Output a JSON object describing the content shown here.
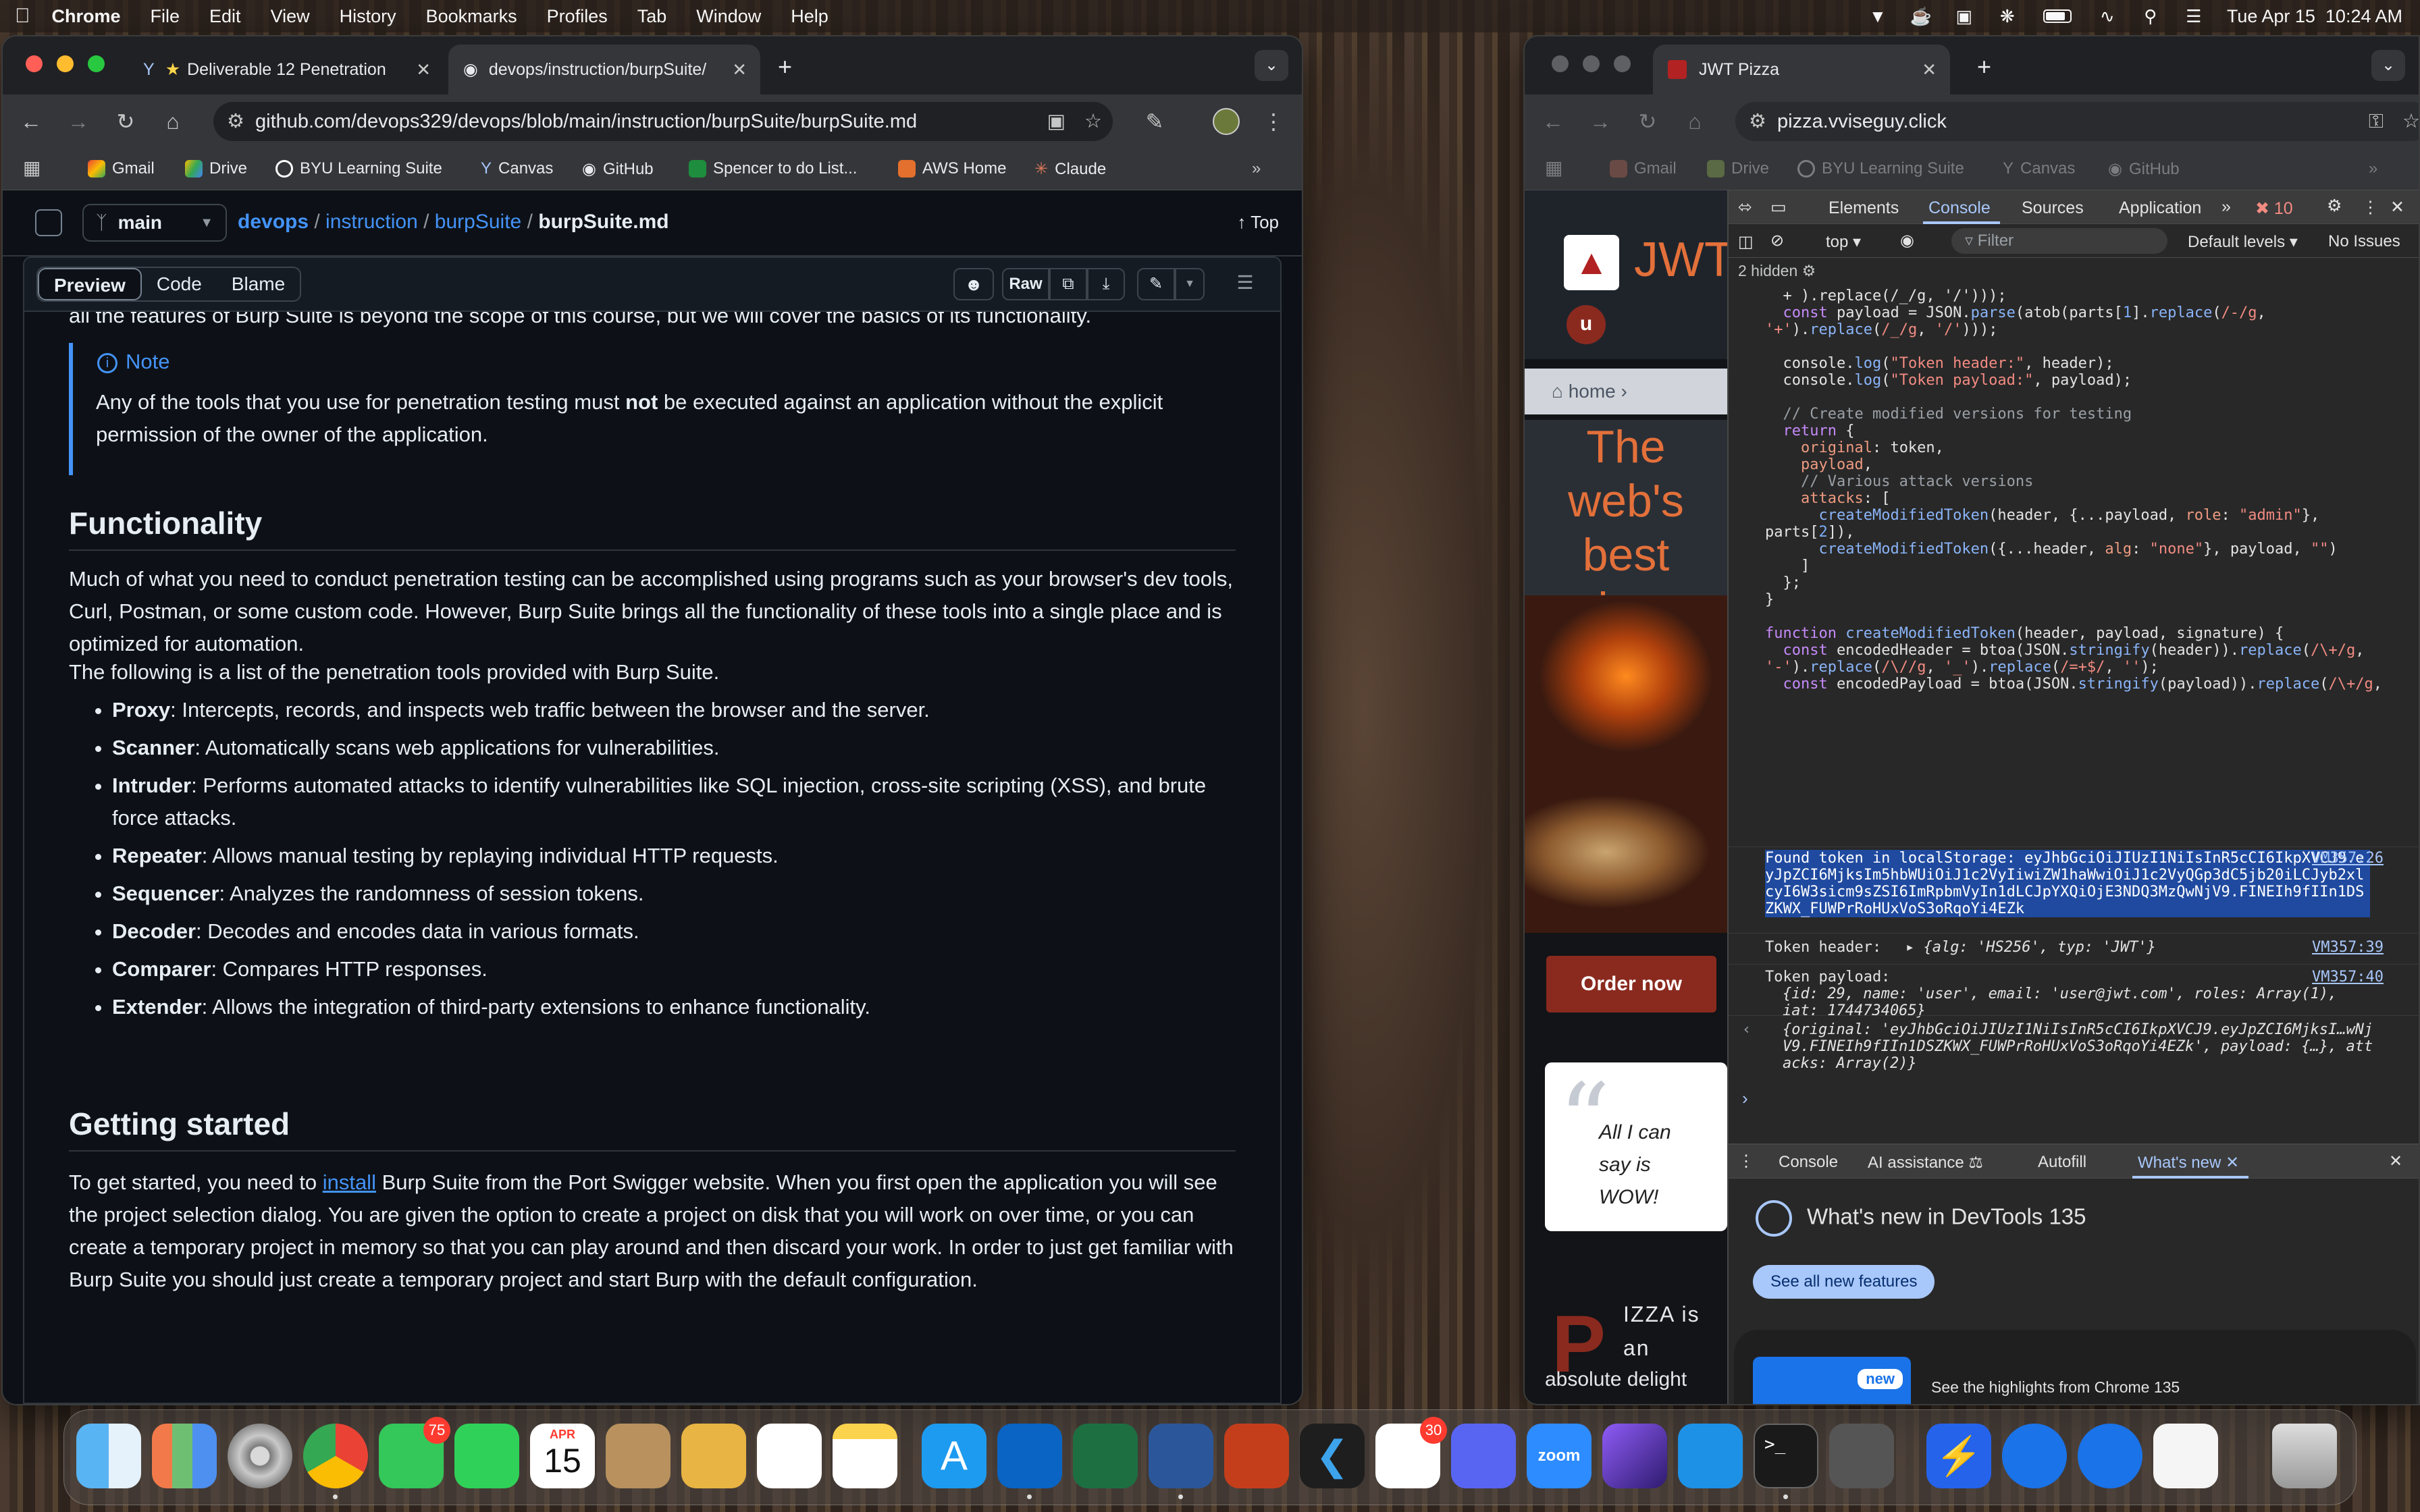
{
  "menubar": {
    "app": "Chrome",
    "items": [
      "File",
      "Edit",
      "View",
      "History",
      "Bookmarks",
      "Profiles",
      "Tab",
      "Window",
      "Help"
    ],
    "datetime": "Tue Apr 15  10:24 AM"
  },
  "left_window": {
    "tabs": [
      {
        "title": "Deliverable 12 Penetration",
        "active": false
      },
      {
        "title": "devops/instruction/burpSuite/",
        "active": true
      }
    ],
    "url": "github.com/devops329/devops/blob/main/instruction/burpSuite/burpSuite.md",
    "bookmarks": [
      "Gmail",
      "Drive",
      "BYU Learning Suite",
      "Canvas",
      "GitHub",
      "Spencer to do List...",
      "AWS Home",
      "Claude"
    ],
    "github": {
      "branch": "main",
      "breadcrumb": [
        "devops",
        "instruction",
        "burpSuite"
      ],
      "file": "burpSuite.md",
      "top_label": "Top",
      "view_tabs": [
        "Preview",
        "Code",
        "Blame"
      ],
      "raw_label": "Raw",
      "cut_line": "all the features of Burp Suite is beyond the scope of this course, but we will cover the basics of its functionality.",
      "note_title": "Note",
      "note_text_a": "Any of the tools that you use for penetration testing must ",
      "note_text_b": "not",
      "note_text_c": " be executed against an application without the explicit permission of the owner of the application.",
      "h_functionality": "Functionality",
      "p1": "Much of what you need to conduct penetration testing can be accomplished using programs such as your browser's dev tools, Curl, Postman, or some custom code. However, Burp Suite brings all the functionality of these tools into a single place and is optimized for automation.",
      "p2": "The following is a list of the penetration tools provided with Burp Suite.",
      "tools": [
        {
          "name": "Proxy",
          "desc": ": Intercepts, records, and inspects web traffic between the browser and the server."
        },
        {
          "name": "Scanner",
          "desc": ": Automatically scans web applications for vulnerabilities."
        },
        {
          "name": "Intruder",
          "desc": ": Performs automated attacks to identify vulnerabilities like SQL injection, cross-site scripting (XSS), and brute force attacks."
        },
        {
          "name": "Repeater",
          "desc": ": Allows manual testing by replaying individual HTTP requests."
        },
        {
          "name": "Sequencer",
          "desc": ": Analyzes the randomness of session tokens."
        },
        {
          "name": "Decoder",
          "desc": ": Decodes and encodes data in various formats."
        },
        {
          "name": "Comparer",
          "desc": ": Compares HTTP responses."
        },
        {
          "name": "Extender",
          "desc": ": Allows the integration of third-party extensions to enhance functionality."
        }
      ],
      "h_getting_started": "Getting started",
      "gs_a": "To get started, you need to ",
      "gs_link": "install",
      "gs_b": " Burp Suite from the Port Swigger website. When you first open the application you will see the project selection dialog. You are given the option to create a project on disk that you will work on over time, or you can create a temporary project in memory so that you can play around and then discard your work. In order to just get familiar with Burp Suite you should just create a temporary project and start Burp with the default configuration."
    }
  },
  "right_window": {
    "tab_title": "JWT Pizza",
    "url": "pizza.vviseguy.click",
    "bookmarks": [
      "Gmail",
      "Drive",
      "BYU Learning Suite",
      "Canvas",
      "GitHub"
    ],
    "site": {
      "brand": "JWT",
      "user_initial": "u",
      "crumb": "home",
      "hero": "The web's best pizza",
      "order_button": "Order now",
      "quote": "All I can say is WOW!",
      "pizza_letter": "P",
      "pizza_text": "IZZA is an",
      "cut_text": "absolute delight"
    },
    "devtools": {
      "tabs": [
        "Elements",
        "Console",
        "Sources",
        "Application"
      ],
      "active_tab": "Console",
      "error_count": "10",
      "context": "top",
      "filter_placeholder": "Filter",
      "levels": "Default levels",
      "issues": "No Issues",
      "hidden": "2 hidden",
      "log_found_label": "Found token in localStorage:",
      "token": "eyJhbGciOiJIUzI1NiIsInR5cCI6IkpXVCJ9.eyJpZCI6MjksIm5hbWUiOiJ1c2VyIiwiZW1haWwiOiJ1c2VyQGp3dC5jb20iLCJyb2xlcyI6W3sicm9sZSI6ImRpbmVyIn1dLCJpYXQiOjE3NDQ3MzQwNjV9.FINEIh9fIIn1DSZKWX_FUWPrRoHUxVoS3oRqoYi4EZk",
      "src_found": "VM357:26",
      "log_header_label": "Token header:",
      "header_obj": "{alg: 'HS256', typ: 'JWT'}",
      "src_header": "VM357:39",
      "log_payload_label": "Token payload:",
      "payload_obj": "{id: 29, name: 'user', email: 'user@jwt.com', roles: Array(1), iat: 1744734065}",
      "src_payload": "VM357:40",
      "result_obj": "{original: 'eyJhbGciOiJIUzI1NiIsInR5cCI6IkpXVCJ9.eyJpZCI6MjksI…wNjV9.FINEIh9fIIn1DSZKWX_FUWPrRoHUxVoS3oRqoYi4EZk', payload: {…}, attacks: Array(2)}",
      "drawer_tabs": [
        "Console",
        "AI assistance",
        "Autofill",
        "What's new"
      ],
      "whats_new_title": "What's new in DevTools 135",
      "see_all": "See all new features",
      "highlight_badge": "new",
      "highlight_text": "See the highlights from Chrome 135"
    }
  },
  "dock": {
    "messages_badge": "75",
    "slack_badge": "30",
    "calendar_month": "APR",
    "calendar_day": "15",
    "zoom_label": "zoom"
  }
}
